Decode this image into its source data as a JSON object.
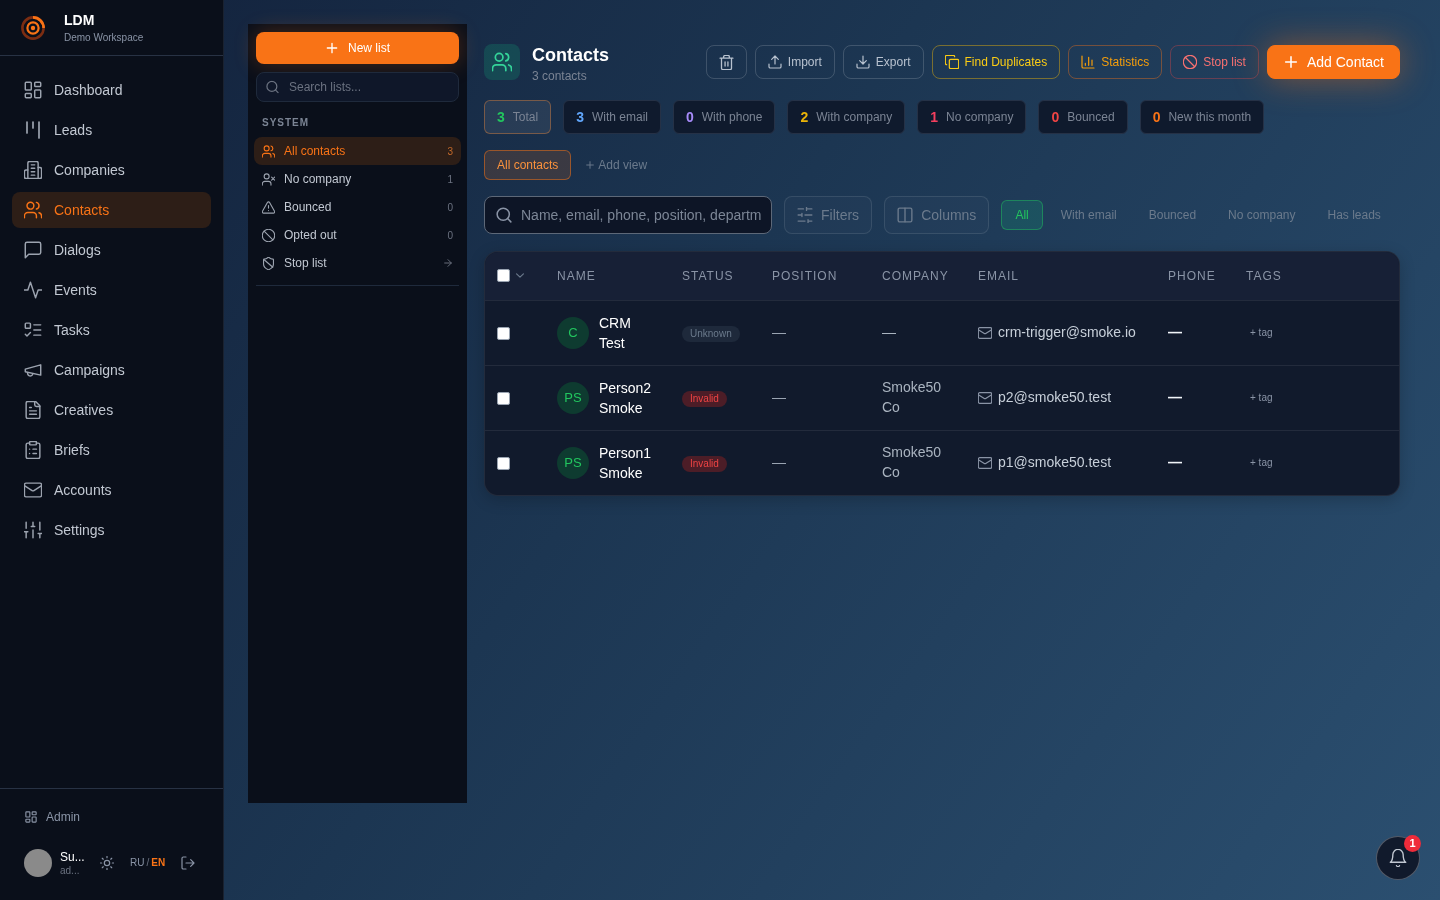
{
  "sidebar": {
    "brand": {
      "name": "LDM",
      "workspace": "Demo Workspace"
    },
    "items": [
      {
        "label": "Dashboard",
        "selected": false
      },
      {
        "label": "Leads",
        "selected": false
      },
      {
        "label": "Companies",
        "selected": false
      },
      {
        "label": "Contacts",
        "selected": true
      },
      {
        "label": "Dialogs",
        "selected": false
      },
      {
        "label": "Events",
        "selected": false
      },
      {
        "label": "Tasks",
        "selected": false
      },
      {
        "label": "Campaigns",
        "selected": false
      },
      {
        "label": "Creatives",
        "selected": false
      },
      {
        "label": "Briefs",
        "selected": false
      },
      {
        "label": "Accounts",
        "selected": false
      },
      {
        "label": "Settings",
        "selected": false
      }
    ],
    "admin_link": "Admin",
    "user": {
      "name": "Su...",
      "email": "ad..."
    },
    "languages": [
      {
        "code": "RU",
        "selected": false
      },
      {
        "code": "EN",
        "selected": true
      }
    ],
    "language_separator": "/"
  },
  "lists_panel": {
    "new_list_button": "New list",
    "search": {
      "placeholder": "Search lists..."
    },
    "section_title": "SYSTEM",
    "items": [
      {
        "label": "All contacts",
        "kind": "count",
        "count": "3",
        "selected": true
      },
      {
        "label": "No company",
        "kind": "count",
        "count": "1",
        "selected": false
      },
      {
        "label": "Bounced",
        "kind": "count",
        "count": "0",
        "selected": false
      },
      {
        "label": "Opted out",
        "kind": "count",
        "count": "0",
        "selected": false
      },
      {
        "label": "Stop list",
        "kind": "link",
        "selected": false
      }
    ]
  },
  "header": {
    "title": "Contacts",
    "subtitle": "3 contacts",
    "actions": [
      {
        "kind": "icon"
      },
      {
        "kind": "outline",
        "label": "Import"
      },
      {
        "kind": "outline",
        "label": "Export"
      },
      {
        "kind": "warning",
        "label": "Find Duplicates"
      },
      {
        "kind": "accent",
        "label": "Statistics"
      },
      {
        "kind": "danger",
        "label": "Stop list"
      },
      {
        "kind": "primary",
        "label": "Add Contact"
      }
    ]
  },
  "stats": [
    {
      "value": "3",
      "label": "Total",
      "color": "#22c55e",
      "selected": true
    },
    {
      "value": "3",
      "label": "With email",
      "color": "#60a5fa",
      "selected": false
    },
    {
      "value": "0",
      "label": "With phone",
      "color": "#a78bfa",
      "selected": false
    },
    {
      "value": "2",
      "label": "With company",
      "color": "#eab308",
      "selected": false
    },
    {
      "value": "1",
      "label": "No company",
      "color": "#f43f5e",
      "selected": false
    },
    {
      "value": "0",
      "label": "Bounced",
      "color": "#ef4444",
      "selected": false
    },
    {
      "value": "0",
      "label": "New this month",
      "color": "#f97316",
      "selected": false
    }
  ],
  "views": {
    "items": [
      {
        "label": "All contacts",
        "selected": true
      }
    ],
    "add_view": "Add view"
  },
  "search": {
    "placeholder": "Name, email, phone, position, departm"
  },
  "filters_button": "Filters",
  "columns_button": "Columns",
  "quick_filters": [
    {
      "label": "All",
      "selected": true
    },
    {
      "label": "With email",
      "selected": false
    },
    {
      "label": "Bounced",
      "selected": false
    },
    {
      "label": "No company",
      "selected": false
    },
    {
      "label": "Has leads",
      "selected": false
    }
  ],
  "table": {
    "select_all_checked": false,
    "columns": [
      "NAME",
      "STATUS",
      "POSITION",
      "COMPANY",
      "EMAIL",
      "PHONE",
      "TAGS"
    ],
    "rows": [
      {
        "checked": false,
        "initials": "C",
        "name": "CRM Test",
        "status": {
          "label": "Unknown",
          "kind": "neutral"
        },
        "position": "—",
        "company": "—",
        "email": "crm-trigger@smoke.io",
        "phone": "—",
        "tag_action": "+ tag"
      },
      {
        "checked": false,
        "initials": "PS",
        "name": "Person2 Smoke",
        "status": {
          "label": "Invalid",
          "kind": "invalid"
        },
        "position": "—",
        "company": "Smoke50 Co",
        "email": "p2@smoke50.test",
        "phone": "—",
        "tag_action": "+ tag"
      },
      {
        "checked": false,
        "initials": "PS",
        "name": "Person1 Smoke",
        "status": {
          "label": "Invalid",
          "kind": "invalid"
        },
        "position": "—",
        "company": "Smoke50 Co",
        "email": "p1@smoke50.test",
        "phone": "—",
        "tag_action": "+ tag"
      }
    ]
  },
  "notifications": {
    "count": "1"
  }
}
